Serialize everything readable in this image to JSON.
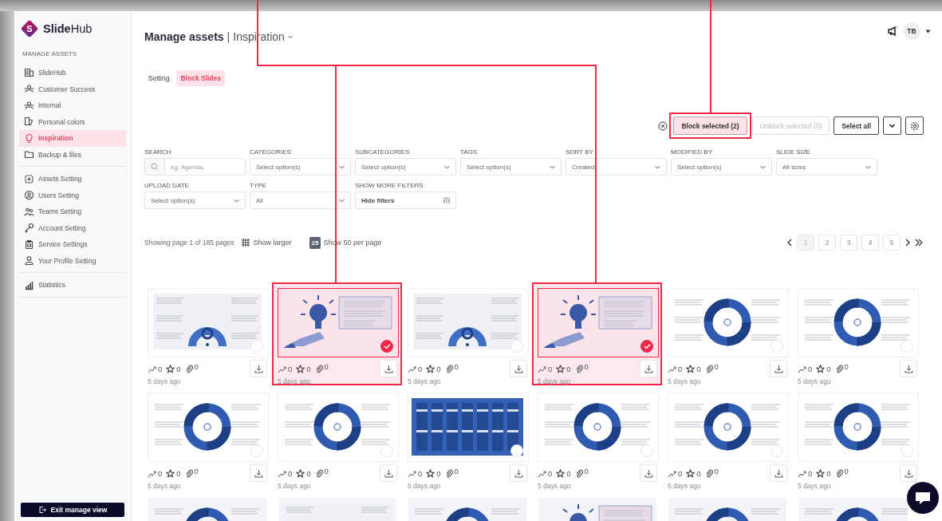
{
  "sidebar": {
    "logo_letter": "S",
    "logo": "**Slide**Hub",
    "section": "MANAGE ASSETS",
    "groups": [
      [
        {
          "label": "SlideHub",
          "selected": false
        },
        {
          "label": "Customer Success",
          "selected": false
        },
        {
          "label": "Internal",
          "selected": false
        },
        {
          "label": "Personal colors",
          "selected": false
        },
        {
          "label": "Inspiration",
          "selected": true
        },
        {
          "label": "Backup & files",
          "selected": false
        }
      ],
      [
        {
          "label": "Assets Setting",
          "selected": false
        },
        {
          "label": "Users Setting",
          "selected": false
        },
        {
          "label": "Teams Setting",
          "selected": false
        },
        {
          "label": "Account Setting",
          "selected": false
        },
        {
          "label": "Service Settings",
          "selected": false
        },
        {
          "label": "Your Profile Setting",
          "selected": false
        }
      ],
      [
        {
          "label": "Statistics",
          "selected": false
        }
      ]
    ],
    "exit_button": "Exit manage view"
  },
  "header": {
    "title": "Manage assets",
    "separator": "|",
    "section": "Inspiration",
    "avatar": "TB"
  },
  "tabs": [
    {
      "label": "Setting",
      "selected": false
    },
    {
      "label": "Block Slides",
      "selected": true
    }
  ],
  "actions": [
    {
      "label": "Block selected (2)",
      "kind": "highlighted"
    },
    {
      "label": "Unblock selected (0)",
      "kind": "disabled"
    },
    {
      "label": "Select all",
      "kind": "outline"
    }
  ],
  "filters": [
    {
      "label": "SEARCH",
      "kind": "search",
      "placeholder": "eg. Agenda"
    },
    {
      "label": "CATEGORIES",
      "kind": "select",
      "value": "Select option(s)"
    },
    {
      "label": "SUBCATEGORIES",
      "kind": "select",
      "value": "Select option(s)"
    },
    {
      "label": "TAGS",
      "kind": "select",
      "value": "Select option(s)"
    },
    {
      "label": "SORT BY",
      "kind": "select",
      "value": "Created"
    },
    {
      "label": "MODIFIED BY",
      "kind": "select",
      "value": "Select option(s)"
    },
    {
      "label": "SLIDE SIZE",
      "kind": "select",
      "value": "All sizes"
    },
    {
      "label": "UPLOAD DATE",
      "kind": "select",
      "value": "Select option(s)"
    },
    {
      "label": "TYPE",
      "kind": "select",
      "value": "All"
    },
    {
      "label": "SHOW MORE FILTERS",
      "kind": "toggle",
      "value": "Hide filters"
    }
  ],
  "listing": {
    "summary": "Showing page 1 of 185 pages",
    "larger": "Show larger",
    "per_page": "25",
    "per_page_option": "Show 50 per page",
    "pages": [
      {
        "label": "1",
        "selected": true
      },
      {
        "label": "2",
        "selected": false
      },
      {
        "label": "3",
        "selected": false
      },
      {
        "label": "4",
        "selected": false
      },
      {
        "label": "5",
        "selected": false
      }
    ]
  },
  "cards": [
    {
      "selected": false,
      "views": "0",
      "favorites": "0",
      "attachments": "0",
      "age": "5 days ago"
    },
    {
      "selected": true,
      "views": "0",
      "favorites": "0",
      "attachments": "0",
      "age": "5 days ago"
    },
    {
      "selected": false,
      "views": "0",
      "favorites": "0",
      "attachments": "0",
      "age": "5 days ago"
    },
    {
      "selected": true,
      "views": "0",
      "favorites": "0",
      "attachments": "0",
      "age": "5 days ago"
    },
    {
      "selected": false,
      "views": "0",
      "favorites": "0",
      "attachments": "0",
      "age": "5 days ago"
    },
    {
      "selected": false,
      "views": "0",
      "favorites": "0",
      "attachments": "0",
      "age": "5 days ago"
    },
    {
      "selected": false,
      "views": "0",
      "favorites": "0",
      "attachments": "0",
      "age": "5 days ago"
    },
    {
      "selected": false,
      "views": "0",
      "favorites": "0",
      "attachments": "0",
      "age": "5 days ago"
    },
    {
      "selected": false,
      "views": "0",
      "favorites": "0",
      "attachments": "0",
      "age": "5 days ago"
    },
    {
      "selected": false,
      "views": "0",
      "favorites": "0",
      "attachments": "0",
      "age": "5 days ago"
    },
    {
      "selected": false,
      "views": "0",
      "favorites": "0",
      "attachments": "0",
      "age": "5 days ago"
    },
    {
      "selected": false,
      "views": "0",
      "favorites": "0",
      "attachments": "0",
      "age": "5 days ago"
    },
    {
      "selected": false
    },
    {
      "selected": false
    },
    {
      "selected": false
    },
    {
      "selected": false
    },
    {
      "selected": false
    },
    {
      "selected": false
    }
  ]
}
